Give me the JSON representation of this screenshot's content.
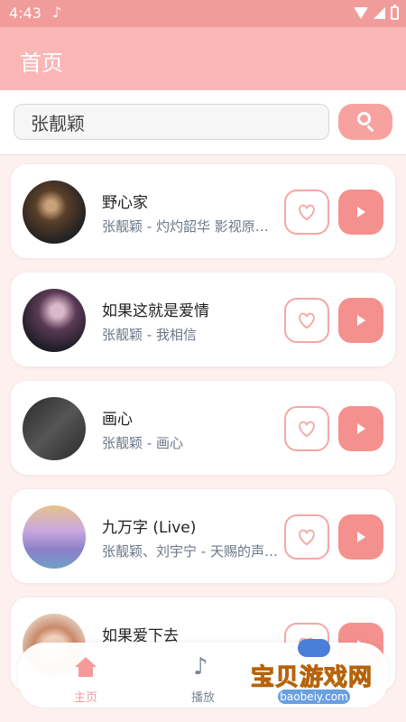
{
  "status_bar": {
    "time": "4:43",
    "note_glyph": "♪",
    "icons": [
      "music-note-icon",
      "wifi-icon",
      "signal-icon",
      "battery-icon"
    ]
  },
  "app_bar": {
    "title": "首页"
  },
  "search": {
    "value": "张靓颖",
    "button_icon": "search-icon"
  },
  "songs": [
    {
      "title": "野心家",
      "subtitle": "张靓颖 - 灼灼韶华 影视原声带",
      "cover_colors": [
        "#222",
        "#5a3f2a"
      ]
    },
    {
      "title": "如果这就是爱情",
      "subtitle": "张靓颖 - 我相信",
      "cover_colors": [
        "#1c1c24",
        "#5a3a55"
      ]
    },
    {
      "title": "画心",
      "subtitle": "张靓颖 - 画心",
      "cover_colors": [
        "#2a2a2a",
        "#555"
      ]
    },
    {
      "title": "九万字 (Live)",
      "subtitle": "张靓颖、刘宇宁 - 天赐的声音第二季",
      "cover_colors": [
        "#8c7fc8",
        "#e7c28a"
      ]
    },
    {
      "title": "如果爱下去",
      "subtitle": "",
      "cover_colors": [
        "#e9d6c8",
        "#c98a6a"
      ]
    }
  ],
  "bottom_nav": {
    "items": [
      {
        "label": "主页",
        "icon": "home-icon",
        "active": true
      },
      {
        "label": "播放",
        "icon": "music-note-icon",
        "active": false
      }
    ]
  },
  "watermark": {
    "text": "宝贝游戏网",
    "url": "baobeiy.com"
  },
  "colors": {
    "primary": "#f19c9a",
    "appbar": "#fbb7b5",
    "accent": "#f4918e",
    "background": "#fdf0ef"
  }
}
